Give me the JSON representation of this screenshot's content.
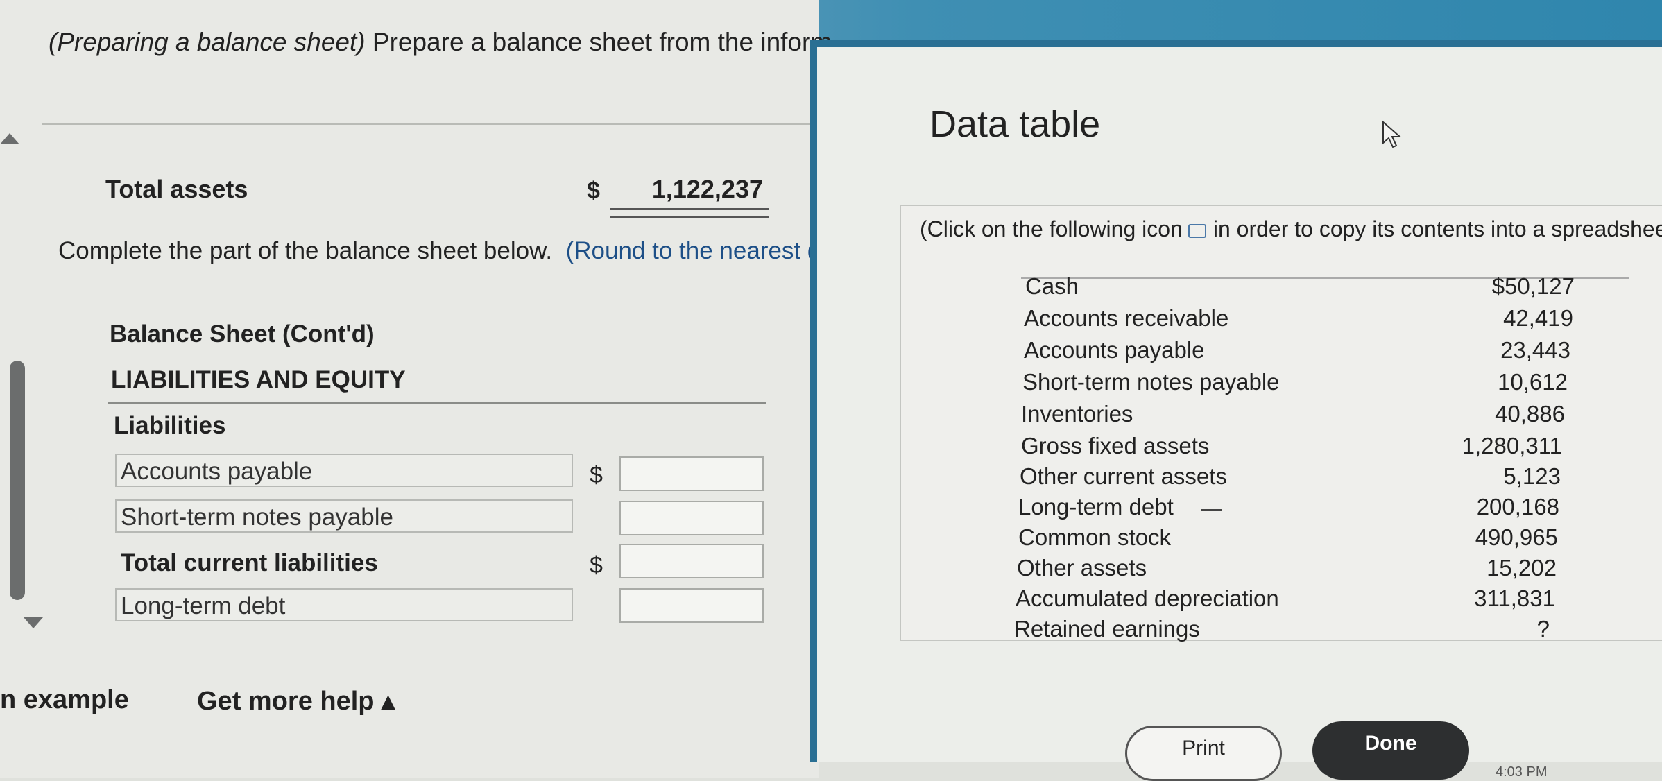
{
  "question": {
    "title_italic": "(Preparing a balance sheet)",
    "title_rest": " Prepare a balance sheet from the inform",
    "total_assets_label": "Total assets",
    "dollar_sign": "$",
    "total_assets_value": "1,122,237",
    "instruction_main": "Complete the part of the balance sheet below.",
    "instruction_paren": "(Round to the nearest do",
    "balance_sheet_title": "Balance Sheet (Cont'd)",
    "section_title": "LIABILITIES AND EQUITY",
    "liabilities_label": "Liabilities",
    "rows": {
      "accounts_payable": "Accounts payable",
      "short_term_notes": "Short-term notes payable",
      "total_current": "Total current liabilities",
      "long_term_debt": "Long-term debt"
    },
    "footer": {
      "example": "n example",
      "help": "Get more help ▴"
    }
  },
  "data_table": {
    "title": "Data table",
    "click_note_a": "(Click on the following icon",
    "click_note_b": "in order to copy its contents into a spreadshee",
    "items": [
      {
        "label": "Cash",
        "value": "$50,127"
      },
      {
        "label": "Accounts receivable",
        "value": "42,419"
      },
      {
        "label": "Accounts payable",
        "value": "23,443"
      },
      {
        "label": "Short-term notes payable",
        "value": "10,612"
      },
      {
        "label": "Inventories",
        "value": "40,886"
      },
      {
        "label": "Gross fixed assets",
        "value": "1,280,311"
      },
      {
        "label": "Other current assets",
        "value": "5,123"
      },
      {
        "label": "Long-term debt",
        "value": "200,168"
      },
      {
        "label": "Common stock",
        "value": "490,965"
      },
      {
        "label": "Other assets",
        "value": "15,202"
      },
      {
        "label": "Accumulated depreciation",
        "value": "311,831"
      },
      {
        "label": "Retained earnings",
        "value": "?"
      }
    ],
    "print_label": "Print",
    "done_label": "Done"
  },
  "clock": "4:03 PM",
  "colors": {
    "accent": "#2a6f93",
    "done_button": "#2d2f30"
  }
}
